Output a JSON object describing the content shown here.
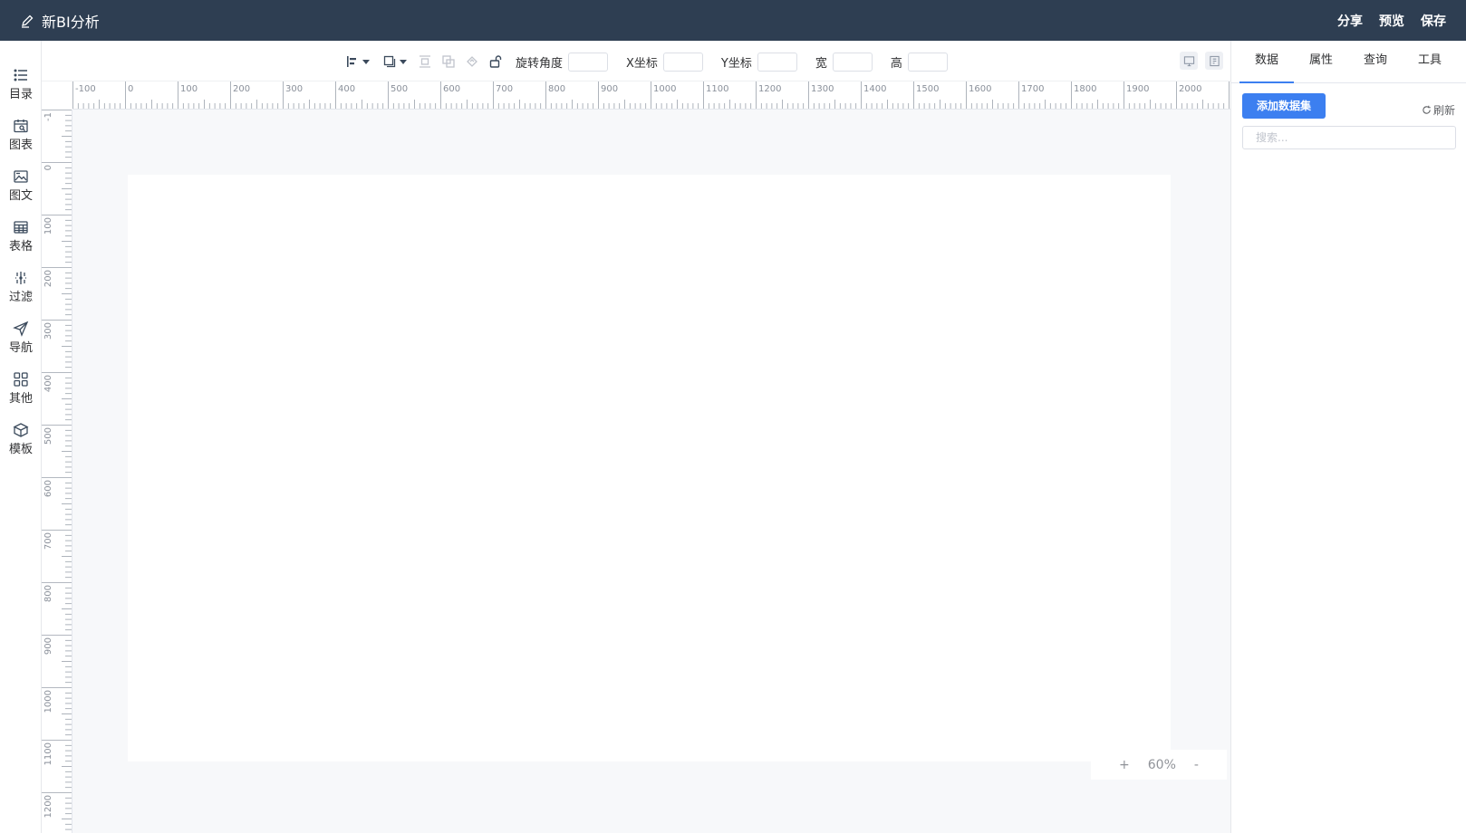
{
  "header": {
    "title": "新BI分析",
    "title_icon": "edit-pen-icon",
    "actions": {
      "share": "分享",
      "preview": "预览",
      "save": "保存"
    }
  },
  "sidebar": {
    "items": [
      {
        "label": "目录",
        "icon": "list-icon"
      },
      {
        "label": "图表",
        "icon": "chart-calendar-icon"
      },
      {
        "label": "图文",
        "icon": "image-icon"
      },
      {
        "label": "表格",
        "icon": "table-icon"
      },
      {
        "label": "过滤",
        "icon": "filter-icon"
      },
      {
        "label": "导航",
        "icon": "navigation-icon"
      },
      {
        "label": "其他",
        "icon": "grid-apps-icon"
      },
      {
        "label": "模板",
        "icon": "template-cube-icon"
      }
    ]
  },
  "toolbar": {
    "rotate_label": "旋转角度",
    "x_label": "X坐标",
    "y_label": "Y坐标",
    "width_label": "宽",
    "height_label": "高",
    "rotate_value": "",
    "x_value": "",
    "y_value": "",
    "width_value": "",
    "height_value": ""
  },
  "rulers": {
    "horizontal_ticks": [
      "-100",
      "0",
      "100",
      "200",
      "300",
      "400",
      "500",
      "600",
      "700",
      "800",
      "900",
      "1000",
      "1100",
      "1200",
      "1300",
      "1400",
      "1500",
      "1600",
      "1700",
      "1800",
      "1900",
      "2000"
    ],
    "vertical_ticks": [
      "-1",
      "0",
      "100",
      "200",
      "300",
      "400",
      "500",
      "600",
      "700",
      "800",
      "900",
      "1000",
      "1100",
      "1200"
    ]
  },
  "zoom": {
    "plus": "+",
    "level": "60%",
    "minus": "-"
  },
  "right_panel": {
    "tabs": [
      "数据",
      "属性",
      "查询",
      "工具"
    ],
    "active_tab": 0,
    "add_dataset_label": "添加数据集",
    "refresh_label": "刷新",
    "search_placeholder": "搜索...",
    "accent_color": "#3c7ff0"
  },
  "colors": {
    "header_bg": "#2e3e52",
    "canvas_bg": "#f7f8fa"
  }
}
